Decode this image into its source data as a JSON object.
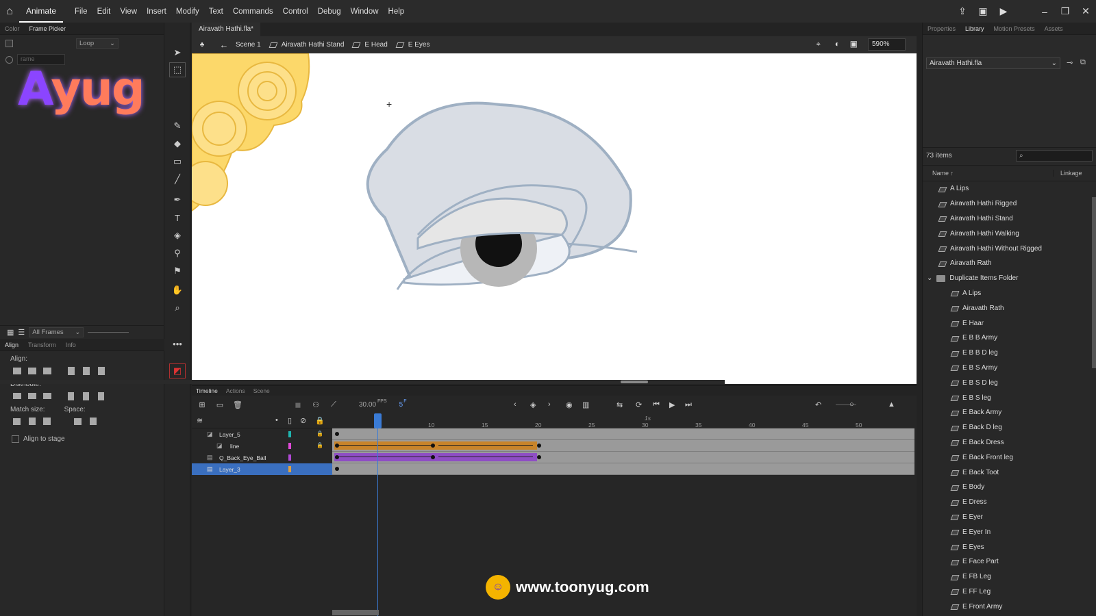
{
  "menubar": {
    "app": "Animate",
    "menus": [
      "File",
      "Edit",
      "View",
      "Insert",
      "Modify",
      "Text",
      "Commands",
      "Control",
      "Debug",
      "Window",
      "Help"
    ]
  },
  "left": {
    "tabs": [
      "Color",
      "Frame Picker"
    ],
    "loop_select": "Loop",
    "frame_input_placeholder": "rame",
    "all_frames": "All Frames",
    "bottom_tabs": [
      "Align",
      "Transform",
      "Info"
    ],
    "align_label": "Align:",
    "distribute_label": "Distribute:",
    "match_size_label": "Match size:",
    "space_label": "Space:",
    "align_to_stage": "Align to stage"
  },
  "document": {
    "tab": "Airavath Hathi.fla*",
    "breadcrumbs": [
      "Scene 1",
      "Airavath Hathi Stand",
      "E Head",
      "E Eyes"
    ],
    "zoom": "590%"
  },
  "right": {
    "tabs": [
      "Properties",
      "Library",
      "Motion Presets",
      "Assets"
    ],
    "library_file": "Airavath Hathi.fla",
    "count": "73 items",
    "col_name": "Name",
    "col_linkage": "Linkage",
    "items": [
      "A Lips",
      "Airavath Hathi Rigged",
      "Airavath Hathi Stand",
      "Airavath Hathi Walking",
      "Airavath Hathi Without Rigged",
      "Airavath Rath"
    ],
    "folder": "Duplicate Items Folder",
    "folder_items": [
      "A Lips",
      "Airavath Rath",
      "E  Haar",
      "E B B Army",
      "E B B D leg",
      "E B S Army",
      "E B S D leg",
      "E B S leg",
      "E Back  Army",
      "E Back D leg",
      "E Back Dress",
      "E Back Front leg",
      "E Back Toot",
      "E Body",
      "E Dress",
      "E Eyer",
      "E Eyer In",
      "E Eyes",
      "E Face Part",
      "E FB Leg",
      "E FF Leg",
      "E Front Army"
    ]
  },
  "timeline": {
    "tabs": [
      "Timeline",
      "Actions",
      "Scene"
    ],
    "fps": "30.00",
    "fps_unit": "FPS",
    "frame": "5",
    "frame_unit": "F",
    "ruler_label": "1s",
    "ruler_numbers": [
      "5",
      "10",
      "15",
      "20",
      "25",
      "30",
      "35",
      "40",
      "45",
      "50"
    ],
    "layers": [
      {
        "name": "Layer_5",
        "color": "#1fb5b0"
      },
      {
        "name": "line",
        "color": "#e04ad8"
      },
      {
        "name": "Q_Back_Eye_Ball",
        "color": "#b049d6"
      },
      {
        "name": "Layer_3",
        "color": "#e0a040"
      }
    ]
  },
  "watermark": {
    "url": "www.toonyug.com",
    "logo": "Ayug"
  }
}
